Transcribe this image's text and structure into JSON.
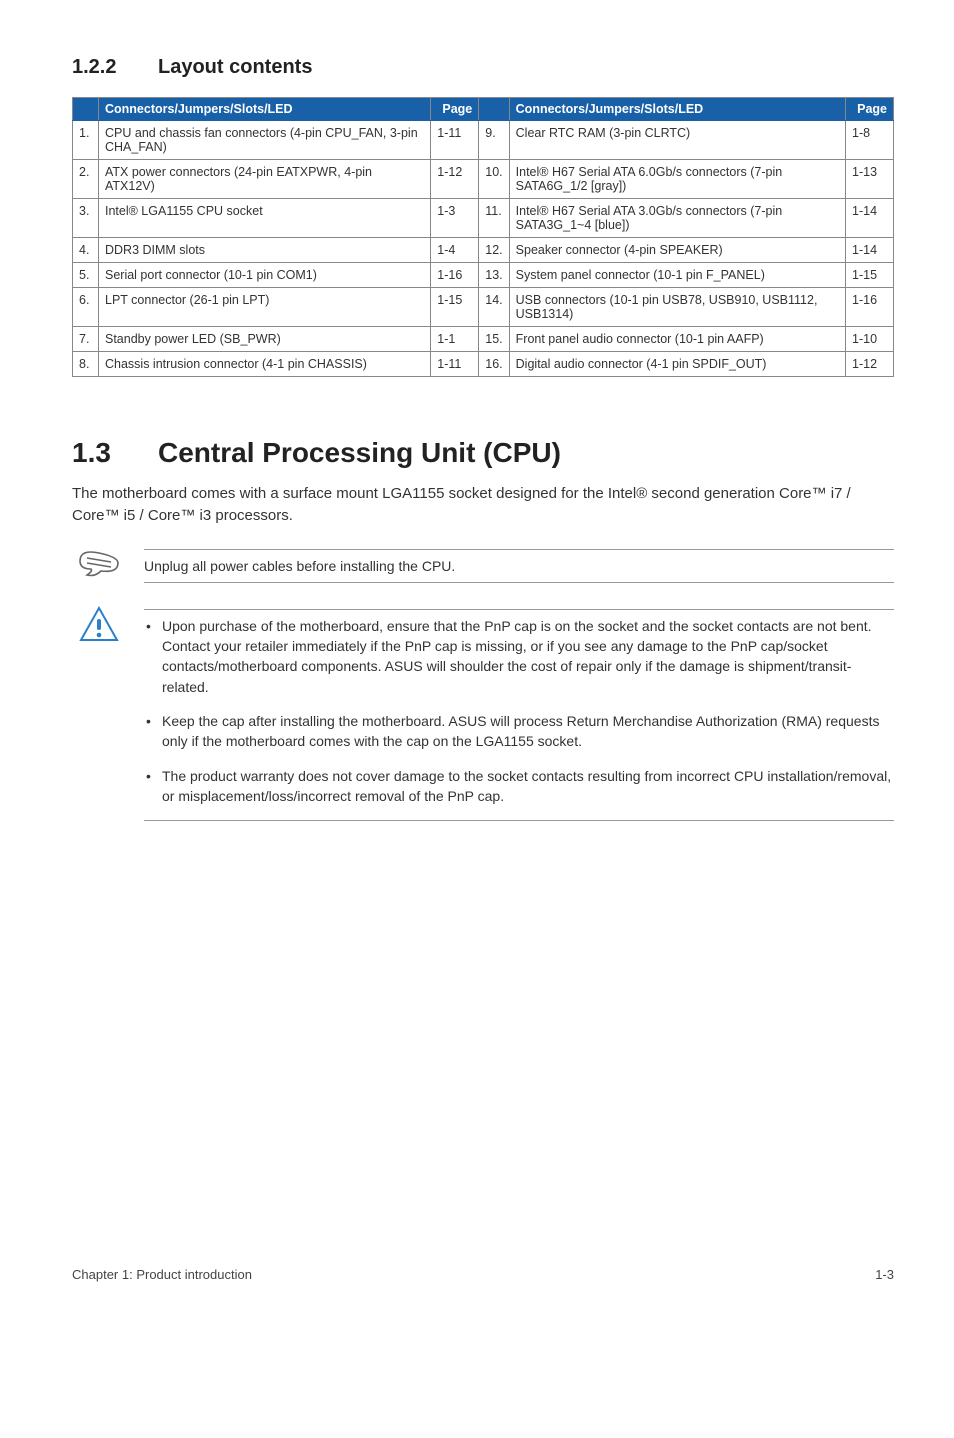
{
  "section122": {
    "number": "1.2.2",
    "title": "Layout contents"
  },
  "table": {
    "head_left": "Connectors/Jumpers/Slots/LED",
    "head_page": "Page",
    "head_right": "Connectors/Jumpers/Slots/LED",
    "rows": [
      {
        "ln": "1.",
        "ld": "CPU and chassis fan connectors (4-pin CPU_FAN, 3-pin CHA_FAN)",
        "lp": "1-11",
        "rn": "9.",
        "rd": "Clear RTC RAM (3-pin CLRTC)",
        "rp": "1-8"
      },
      {
        "ln": "2.",
        "ld": "ATX power connectors (24-pin EATXPWR, 4-pin ATX12V)",
        "lp": "1-12",
        "rn": "10.",
        "rd": "Intel® H67 Serial ATA 6.0Gb/s connectors (7-pin SATA6G_1/2 [gray])",
        "rp": "1-13"
      },
      {
        "ln": "3.",
        "ld": "Intel® LGA1155 CPU socket",
        "lp": "1-3",
        "rn": "11.",
        "rd": "Intel® H67 Serial ATA 3.0Gb/s connectors (7-pin SATA3G_1~4 [blue])",
        "rp": "1-14"
      },
      {
        "ln": "4.",
        "ld": "DDR3 DIMM slots",
        "lp": "1-4",
        "rn": "12.",
        "rd": "Speaker connector (4-pin SPEAKER)",
        "rp": "1-14"
      },
      {
        "ln": "5.",
        "ld": "Serial port connector (10-1 pin COM1)",
        "lp": "1-16",
        "rn": "13.",
        "rd": "System panel connector (10-1 pin F_PANEL)",
        "rp": "1-15"
      },
      {
        "ln": "6.",
        "ld": "LPT connector (26-1 pin LPT)",
        "lp": "1-15",
        "rn": "14.",
        "rd": "USB connectors (10-1 pin USB78, USB910, USB1112, USB1314)",
        "rp": "1-16"
      },
      {
        "ln": "7.",
        "ld": "Standby power LED (SB_PWR)",
        "lp": "1-1",
        "rn": "15.",
        "rd": "Front panel audio connector (10-1 pin AAFP)",
        "rp": "1-10"
      },
      {
        "ln": "8.",
        "ld": "Chassis intrusion connector (4-1 pin CHASSIS)",
        "lp": "1-11",
        "rn": "16.",
        "rd": "Digital audio connector (4-1 pin SPDIF_OUT)",
        "rp": "1-12"
      }
    ]
  },
  "section13": {
    "number": "1.3",
    "title": "Central Processing Unit (CPU)",
    "intro": "The motherboard comes with a surface mount LGA1155 socket designed for the Intel® second generation Core™ i7 / Core™ i5 / Core™ i3 processors."
  },
  "note": "Unplug all power cables before installing the CPU.",
  "warnings": [
    "Upon purchase of the motherboard, ensure that the PnP cap is on the socket and the socket contacts are not bent. Contact your retailer immediately if the PnP cap is missing, or if you see any damage to the PnP cap/socket contacts/motherboard components. ASUS will shoulder the cost of repair only if the damage is shipment/transit-related.",
    "Keep the cap after installing the motherboard. ASUS will process Return Merchandise Authorization (RMA) requests only if the motherboard comes with the cap on the LGA1155 socket.",
    "The product warranty does not cover damage to the socket contacts resulting from incorrect CPU installation/removal, or misplacement/loss/incorrect removal of the PnP cap."
  ],
  "footer": {
    "left": "Chapter 1: Product introduction",
    "right": "1-3"
  }
}
